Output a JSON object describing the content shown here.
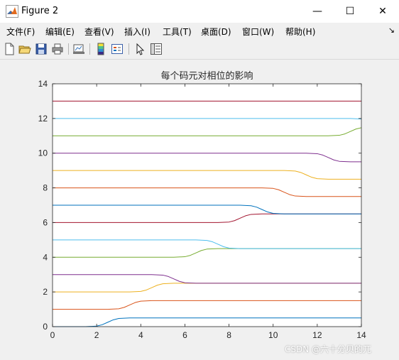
{
  "window": {
    "title": "Figure 2",
    "minimize": "—",
    "maximize": "☐",
    "close": "✕"
  },
  "menu": {
    "items": [
      "文件(F)",
      "编辑(E)",
      "查看(V)",
      "插入(I)",
      "工具(T)",
      "桌面(D)",
      "窗口(W)",
      "帮助(H)"
    ],
    "overflow": "↘"
  },
  "toolbar": {
    "icons": [
      "new-figure-icon",
      "open-file-icon",
      "save-icon",
      "print-icon",
      "link-plot-icon",
      "insert-colorbar-icon",
      "insert-legend-icon",
      "edit-plot-icon",
      "property-inspector-icon"
    ]
  },
  "watermark": "CSDN @六十分贝的兀",
  "chart_data": {
    "type": "line",
    "title": "每个码元对相位的影响",
    "xlabel": "",
    "ylabel": "",
    "xlim": [
      0,
      14
    ],
    "ylim": [
      0,
      14
    ],
    "xticks": [
      0,
      2,
      4,
      6,
      8,
      10,
      12,
      14
    ],
    "yticks": [
      0,
      2,
      4,
      6,
      8,
      10,
      12,
      14
    ],
    "grid": false,
    "colors": [
      "#0072bd",
      "#d95319",
      "#edb120",
      "#7e2f8e",
      "#77ac30",
      "#4dbeee",
      "#a2142f"
    ],
    "series": [
      {
        "x": [
          0,
          1.5,
          2,
          2.25,
          2.5,
          2.75,
          3,
          3.5,
          14
        ],
        "y": [
          0,
          0,
          0.03,
          0.11,
          0.25,
          0.39,
          0.47,
          0.5,
          0.5
        ]
      },
      {
        "x": [
          0,
          2.5,
          3,
          3.25,
          3.5,
          3.75,
          4,
          4.5,
          14
        ],
        "y": [
          1,
          1,
          1.03,
          1.11,
          1.25,
          1.39,
          1.47,
          1.5,
          1.5
        ]
      },
      {
        "x": [
          0,
          3.5,
          4,
          4.25,
          4.5,
          4.75,
          5,
          5.5,
          14
        ],
        "y": [
          2,
          2,
          2.03,
          2.11,
          2.25,
          2.39,
          2.47,
          2.5,
          2.5
        ]
      },
      {
        "x": [
          0,
          4.5,
          5,
          5.25,
          5.5,
          5.75,
          6,
          6.5,
          14
        ],
        "y": [
          3,
          3,
          2.97,
          2.89,
          2.75,
          2.61,
          2.53,
          2.5,
          2.5
        ]
      },
      {
        "x": [
          0,
          5.5,
          6,
          6.25,
          6.5,
          6.75,
          7,
          7.5,
          14
        ],
        "y": [
          4,
          4,
          4.03,
          4.11,
          4.25,
          4.39,
          4.47,
          4.5,
          4.5
        ]
      },
      {
        "x": [
          0,
          6.5,
          7,
          7.25,
          7.5,
          7.75,
          8,
          8.5,
          14
        ],
        "y": [
          5,
          5,
          4.97,
          4.89,
          4.75,
          4.61,
          4.53,
          4.5,
          4.5
        ]
      },
      {
        "x": [
          0,
          7.5,
          8,
          8.25,
          8.5,
          8.75,
          9,
          9.5,
          14
        ],
        "y": [
          6,
          6,
          6.03,
          6.11,
          6.25,
          6.39,
          6.47,
          6.5,
          6.5
        ]
      },
      {
        "x": [
          0,
          8.5,
          9,
          9.25,
          9.5,
          9.75,
          10,
          10.5,
          14
        ],
        "y": [
          7,
          7,
          6.97,
          6.89,
          6.75,
          6.61,
          6.53,
          6.5,
          6.5
        ]
      },
      {
        "x": [
          0,
          9.5,
          10,
          10.25,
          10.5,
          10.75,
          11,
          11.5,
          14
        ],
        "y": [
          8,
          8,
          7.97,
          7.89,
          7.75,
          7.61,
          7.53,
          7.5,
          7.5
        ]
      },
      {
        "x": [
          0,
          10.5,
          11,
          11.25,
          11.5,
          11.75,
          12,
          12.5,
          14
        ],
        "y": [
          9,
          9,
          8.97,
          8.89,
          8.75,
          8.61,
          8.53,
          8.5,
          8.5
        ]
      },
      {
        "x": [
          0,
          11.5,
          12,
          12.25,
          12.5,
          12.75,
          13,
          13.5,
          14
        ],
        "y": [
          10,
          10,
          9.97,
          9.89,
          9.75,
          9.61,
          9.53,
          9.5,
          9.5
        ]
      },
      {
        "x": [
          0,
          12.5,
          13,
          13.25,
          13.5,
          13.75,
          14
        ],
        "y": [
          11,
          11,
          11.03,
          11.11,
          11.25,
          11.39,
          11.47
        ]
      },
      {
        "x": [
          0,
          13.5,
          14
        ],
        "y": [
          12,
          12,
          11.97
        ]
      },
      {
        "x": [
          0,
          14
        ],
        "y": [
          13,
          13
        ]
      }
    ]
  }
}
